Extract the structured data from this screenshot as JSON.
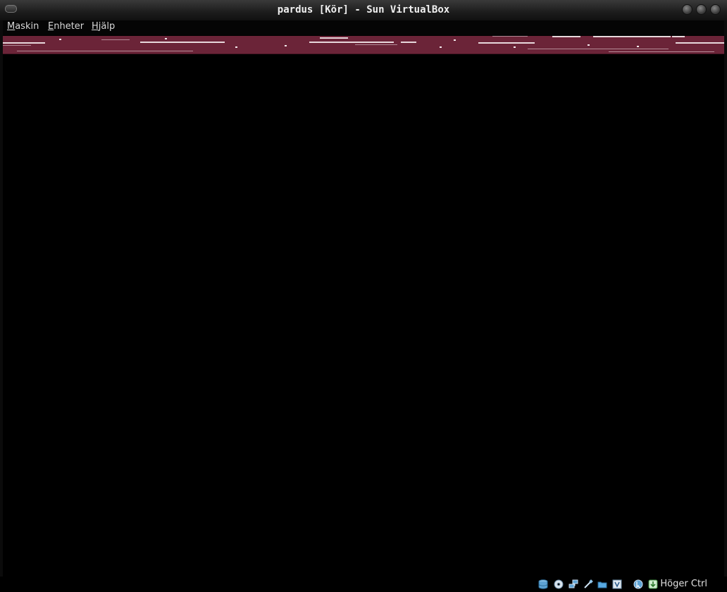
{
  "window": {
    "title": "pardus [Kör] - Sun VirtualBox"
  },
  "menubar": {
    "items": [
      {
        "mnemonic": "M",
        "rest": "askin"
      },
      {
        "mnemonic": "E",
        "rest": "nheter"
      },
      {
        "mnemonic": "H",
        "rest": "jälp"
      }
    ]
  },
  "statusbar": {
    "icons": [
      "hard-disk-icon",
      "optical-disk-icon",
      "network-icon",
      "usb-icon",
      "shared-folders-icon",
      "virtualization-icon",
      "mouse-integration-icon",
      "host-key-icon"
    ],
    "host_key": "Höger Ctrl"
  },
  "colors": {
    "guest_panel": "#6b2438",
    "background": "#000000"
  }
}
